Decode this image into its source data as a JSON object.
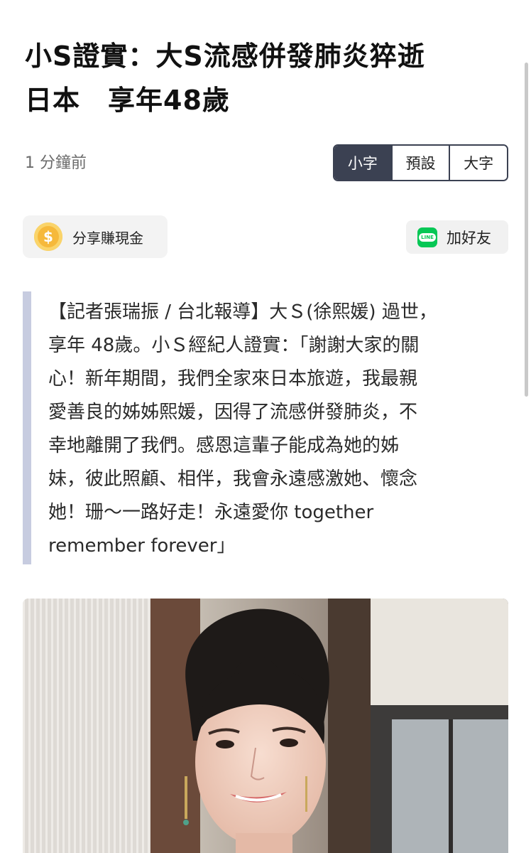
{
  "article": {
    "title_lines": [
      "小S證實：大S流感併發肺炎猝逝",
      "日本　享年48歲"
    ],
    "timestamp": "1 分鐘前",
    "font_size_options": [
      "小字",
      "預設",
      "大字"
    ],
    "font_size_selected": "小字",
    "share_button": {
      "icon": "coin-dollar-icon",
      "icon_glyph": "$",
      "label": "分享賺現金"
    },
    "add_friend_button": {
      "icon": "line-app-icon",
      "icon_text": "LINE",
      "label": "加好友"
    },
    "quote_lines": [
      "【記者張瑞振 / 台北報導】大Ｓ(徐熙媛) 過世，",
      "享年 48歲。小Ｓ經紀人證實：「謝謝大家的關",
      "心！新年期間，我們全家來日本旅遊，我最親",
      "愛善良的姊姊熙媛，因得了流感併發肺炎，不",
      "幸地離開了我們。感恩這輩子能成為她的姊",
      "妹，彼此照顧、相伴，我會永遠感激她、懷念",
      "她！珊～一路好走！永遠愛你 together",
      "remember forever」"
    ]
  },
  "colors": {
    "selected_segment": "#3b4152",
    "quote_bar": "#c7cce0",
    "line_green": "#06c755",
    "coin_gold": "#f6b93b"
  }
}
